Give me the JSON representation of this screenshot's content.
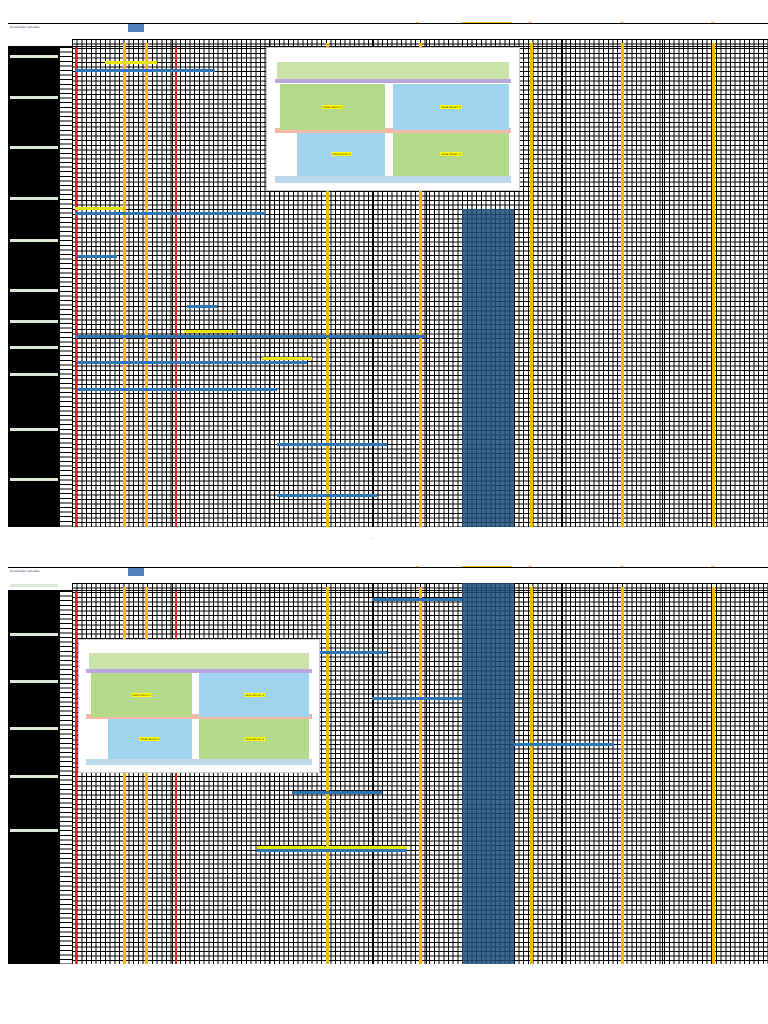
{
  "document": {
    "title": "Construction schedule",
    "page_marker": "- 1 -"
  },
  "colors": {
    "milestone": "#f6b800",
    "today_band": "#1f4e79",
    "task_blue": "#2e75b6",
    "task_yellow": "#e6e600",
    "red_line": "#e02020",
    "section_label": "#d9ead3"
  },
  "floor_plan": {
    "rooms": [
      "Clean Room 1",
      "Clean Room 2",
      "Clean Room 3",
      "Clean Room 4"
    ]
  }
}
